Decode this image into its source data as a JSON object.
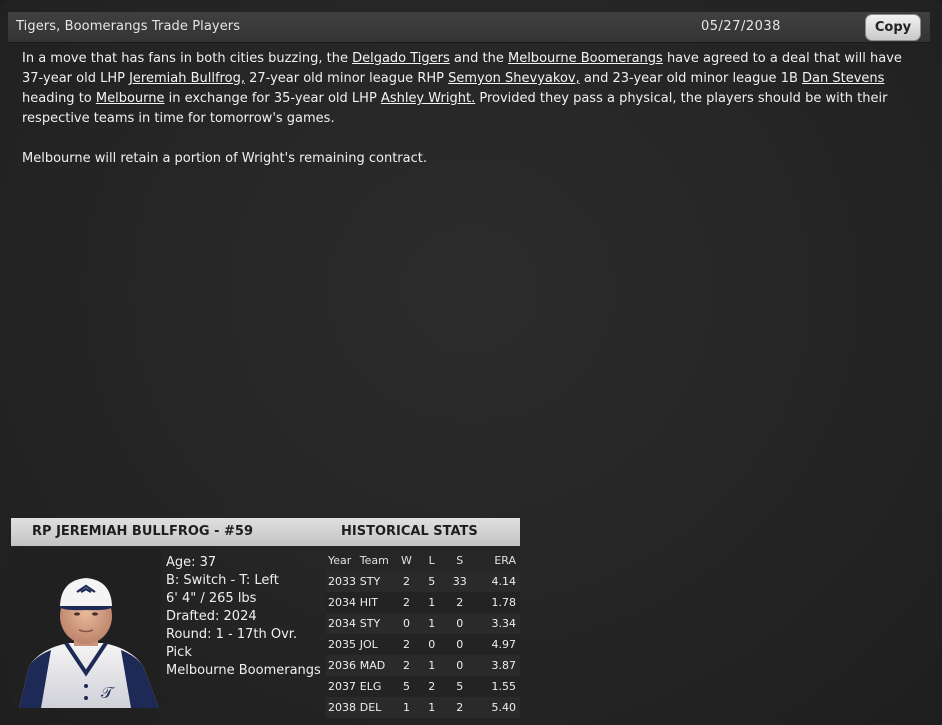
{
  "header": {
    "title": "Tigers, Boomerangs Trade Players",
    "date": "05/27/2038",
    "copy_label": "Copy"
  },
  "article": {
    "p1": {
      "t1": "In a move that has fans in both cities buzzing, the ",
      "l1": "Delgado Tigers",
      "t2": " and the ",
      "l2": "Melbourne Boomerangs",
      "t3": " have agreed to a deal that will have 37-year old LHP ",
      "l3": "Jeremiah Bullfrog,",
      "t4": " 27-year old minor league RHP ",
      "l4": "Semyon Shevyakov,",
      "t5": " and 23-year old minor league 1B ",
      "l5": "Dan Stevens",
      "t6": " heading to ",
      "l6": "Melbourne",
      "t7": " in exchange for 35-year old LHP ",
      "l7": "Ashley Wright.",
      "t8": " Provided they pass a physical, the players should be with their respective teams in time for tomorrow's games."
    },
    "p2": "Melbourne will retain a portion of Wright's remaining contract."
  },
  "player_card": {
    "title": "RP JEREMIAH BULLFROG - #59",
    "stats_title": "HISTORICAL STATS",
    "photo_icon": "player-portrait",
    "bio": {
      "age": "Age: 37",
      "bats_throws": "B: Switch - T: Left",
      "height_weight": "6' 4\" / 265 lbs",
      "drafted": "Drafted: 2024",
      "round": "Round: 1 - 17th Ovr. Pick",
      "team": "Melbourne Boomerangs"
    },
    "stats": {
      "columns": [
        "Year",
        "Team",
        "W",
        "L",
        "S",
        "ERA"
      ],
      "rows": [
        [
          "2033",
          "STY",
          "2",
          "5",
          "33",
          "4.14"
        ],
        [
          "2034",
          "HIT",
          "2",
          "1",
          "2",
          "1.78"
        ],
        [
          "2034",
          "STY",
          "0",
          "1",
          "0",
          "3.34"
        ],
        [
          "2035",
          "JOL",
          "2",
          "0",
          "0",
          "4.97"
        ],
        [
          "2036",
          "MAD",
          "2",
          "1",
          "0",
          "3.87"
        ],
        [
          "2037",
          "ELG",
          "5",
          "2",
          "5",
          "1.55"
        ],
        [
          "2038",
          "DEL",
          "1",
          "1",
          "2",
          "5.40"
        ]
      ]
    }
  }
}
